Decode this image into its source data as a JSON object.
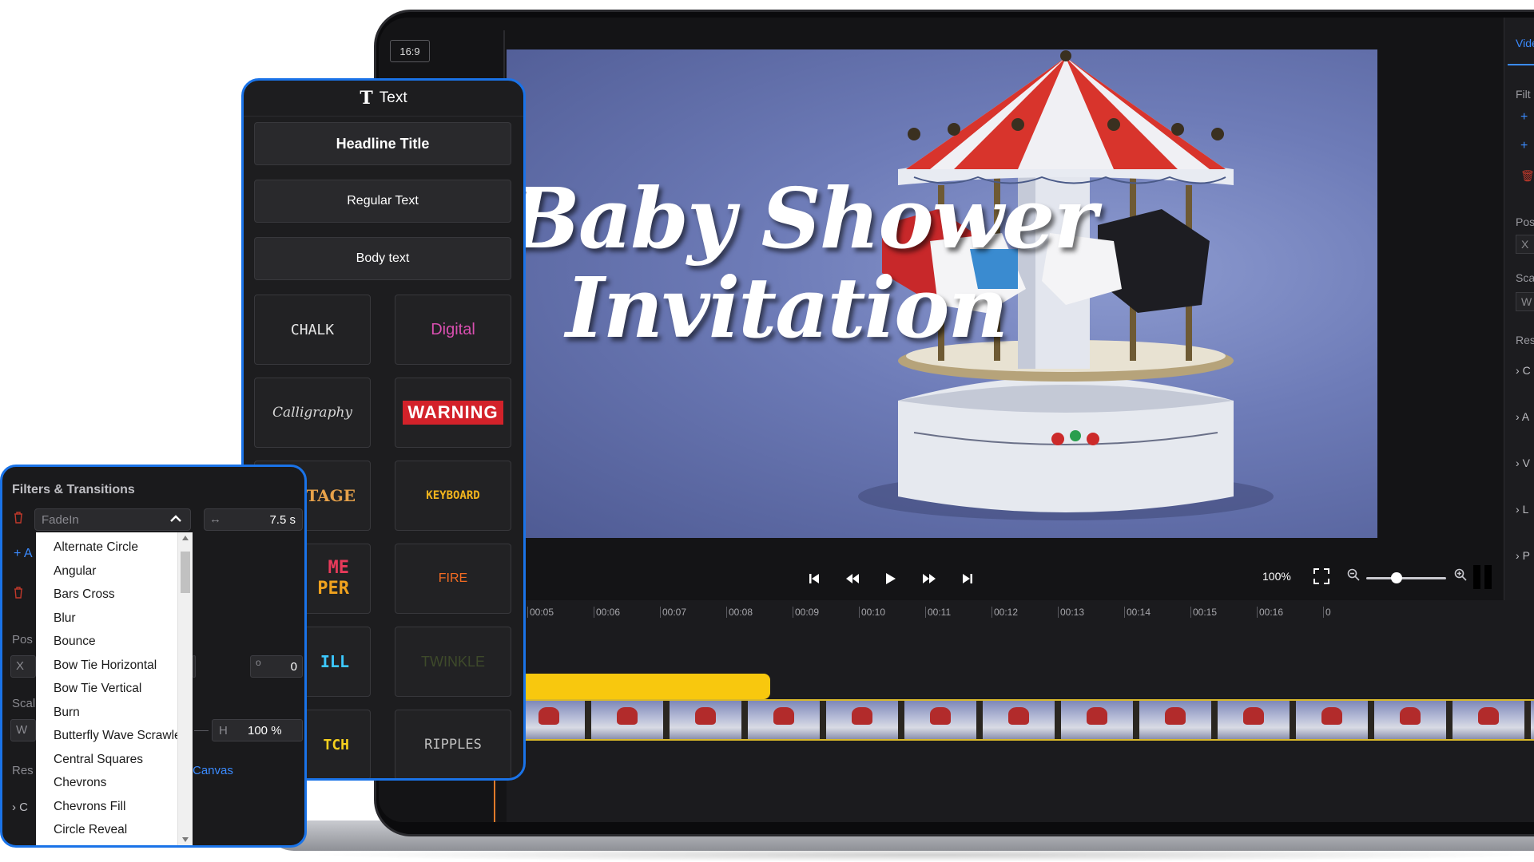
{
  "editor": {
    "aspect_ratio": "16:9",
    "preview": {
      "title_line1": "Baby Shower",
      "title_line2": "Invitation"
    },
    "right_panel": {
      "tab_label": "Vide",
      "filters_label": "Filt",
      "position_label": "Pos",
      "position_x_prefix": "X",
      "scale_label": "Sca",
      "scale_w_prefix": "W",
      "resize_label": "Res",
      "collapsed_items": [
        "C",
        "A",
        "V",
        "L",
        "P"
      ]
    },
    "playback": {
      "zoom_level": "100%",
      "zoom_slider_fraction": 0.38
    },
    "timeline": {
      "ticks": [
        "00:05",
        "00:06",
        "00:07",
        "00:08",
        "00:09",
        "00:10",
        "00:11",
        "00:12",
        "00:13",
        "00:14",
        "00:15",
        "00:16",
        "0"
      ],
      "thumb_count": 14
    }
  },
  "text_panel": {
    "title": "Text",
    "buttons": [
      {
        "label": "Headline Title"
      },
      {
        "label": "Regular Text"
      },
      {
        "label": "Body text"
      }
    ],
    "presets": [
      {
        "label": "CHALK",
        "color": "#e6e6e6"
      },
      {
        "label": "Digital",
        "color": "#d94fb0"
      },
      {
        "label": "Calligraphy",
        "color": "#d8d8d8"
      },
      {
        "label": "WARNING",
        "color": "#ffffff",
        "bg": "#d3222a"
      },
      {
        "label": "TAGE",
        "color": "#e6a14a"
      },
      {
        "label": "KEYBOARD",
        "color": "#f2b51d"
      },
      {
        "label": "ME",
        "label2": "PER",
        "color": "#e83a5a",
        "color2": "#f0a21e"
      },
      {
        "label": "FIRE",
        "color": "#f36b22"
      },
      {
        "label": "ILL",
        "color": "#3cc8ff"
      },
      {
        "label": "TWINKLE",
        "color": "#3e4a2a"
      },
      {
        "label": "TCH",
        "color": "#f5d01e"
      },
      {
        "label": "RIPPLES",
        "color": "#bfbfbf"
      }
    ]
  },
  "filters_panel": {
    "title": "Filters & Transitions",
    "selected_transition": "FadeIn",
    "duration": "7.5 s",
    "add_prefix": "+ A",
    "rotation_value": "0",
    "height_prefix": "H",
    "height_value": "100 %",
    "position_label": "Pos",
    "x_prefix": "X",
    "scale_label": "Scal",
    "w_prefix": "W",
    "resize_label": "Res",
    "canvas_link": "Canvas",
    "collapsed_item": "C",
    "options": [
      "Alternate Circle",
      "Angular",
      "Bars Cross",
      "Blur",
      "Bounce",
      "Bow Tie Horizontal",
      "Bow Tie Vertical",
      "Burn",
      "Butterfly Wave Scrawler",
      "Central Squares",
      "Chevrons",
      "Chevrons Fill",
      "Circle Reveal"
    ]
  }
}
